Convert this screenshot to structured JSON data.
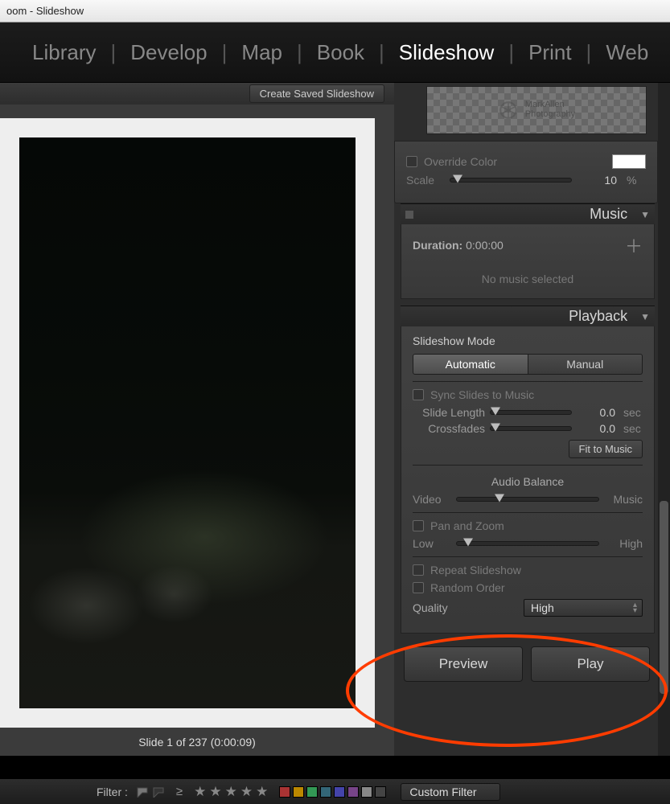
{
  "window": {
    "title": "oom - Slideshow"
  },
  "modules": {
    "items": [
      "Library",
      "Develop",
      "Map",
      "Book",
      "Slideshow",
      "Print",
      "Web"
    ],
    "active": "Slideshow"
  },
  "createSaved": "Create Saved Slideshow",
  "slideInfo": "Slide 1 of 237 (0:00:09)",
  "overlay": {
    "watermark_top": "MarkAllen",
    "watermark_bottom": "Photography",
    "overrideColor_label": "Override Color",
    "overrideColor_checked": false,
    "scale_label": "Scale",
    "scale_value": "10",
    "scale_unit": "%"
  },
  "music": {
    "title": "Music",
    "duration_label": "Duration:",
    "duration_value": "0:00:00",
    "empty": "No music selected"
  },
  "playback": {
    "title": "Playback",
    "mode_label": "Slideshow Mode",
    "mode_auto": "Automatic",
    "mode_manual": "Manual",
    "sync_label": "Sync Slides to Music",
    "slide_len_label": "Slide Length",
    "slide_len_value": "0.0",
    "xfade_label": "Crossfades",
    "xfade_value": "0.0",
    "sec": "sec",
    "fit_btn": "Fit to Music",
    "balance_header": "Audio Balance",
    "balance_left": "Video",
    "balance_right": "Music",
    "pan_label": "Pan and Zoom",
    "pan_left": "Low",
    "pan_right": "High",
    "repeat_label": "Repeat Slideshow",
    "random_label": "Random Order",
    "quality_label": "Quality",
    "quality_value": "High"
  },
  "buttons": {
    "preview": "Preview",
    "play": "Play"
  },
  "footer": {
    "filter_label": "Filter :",
    "custom_filter": "Custom Filter",
    "colors": [
      "#a33",
      "#b80",
      "#395",
      "#367",
      "#44a",
      "#748",
      "#888",
      "#444"
    ]
  }
}
